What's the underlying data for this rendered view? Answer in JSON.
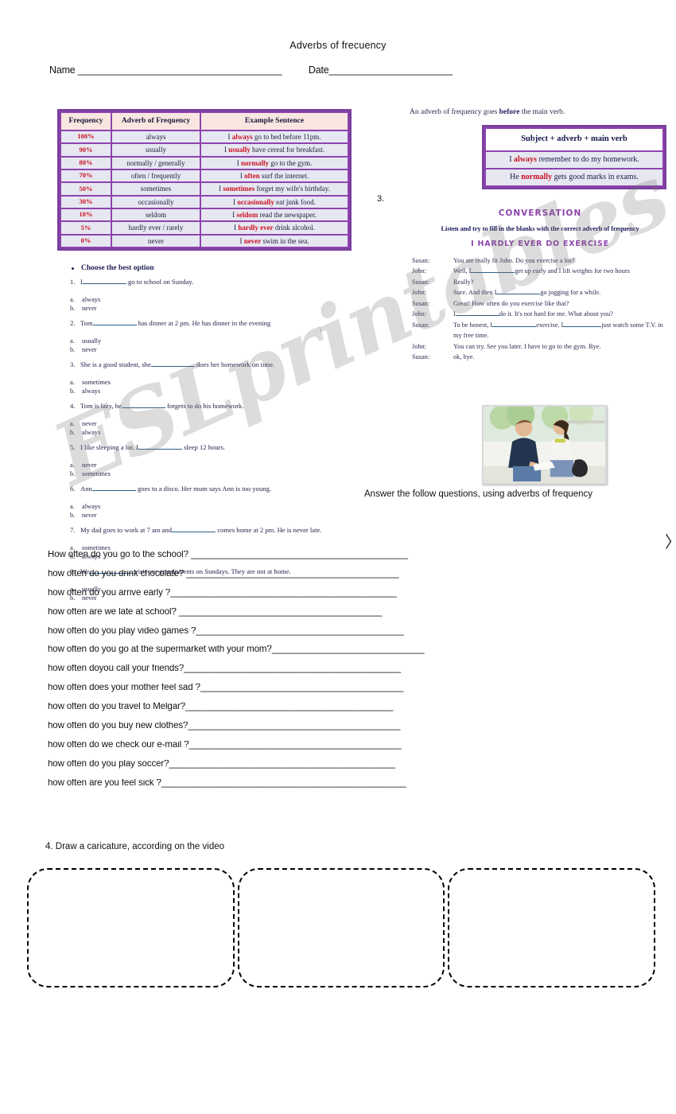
{
  "document": {
    "title": "Adverbs of frecuency",
    "name_label": "Name ______________________________________",
    "date_label": "Date_______________________",
    "watermark": "ESLprintables.com"
  },
  "frequency_table": {
    "headers": [
      "Frequency",
      "Adverb of Frequency",
      "Example Sentence"
    ],
    "rows": [
      {
        "pct": "100%",
        "adverb": "always",
        "prefix": "I ",
        "bold": "always",
        "suffix": " go to bed before 11pm."
      },
      {
        "pct": "90%",
        "adverb": "usually",
        "prefix": "I ",
        "bold": "usually",
        "suffix": " have cereal for breakfast."
      },
      {
        "pct": "80%",
        "adverb": "normally / generally",
        "prefix": "I ",
        "bold": "normally",
        "suffix": " go to the gym."
      },
      {
        "pct": "70%",
        "adverb": "often / frequently",
        "prefix": "I ",
        "bold": "often",
        "suffix": " surf the internet."
      },
      {
        "pct": "50%",
        "adverb": "sometimes",
        "prefix": "I ",
        "bold": "sometimes",
        "suffix": " forget my wife's birthday."
      },
      {
        "pct": "30%",
        "adverb": "occasionally",
        "prefix": "I ",
        "bold": "occasionally",
        "suffix": " eat junk food."
      },
      {
        "pct": "10%",
        "adverb": "seldom",
        "prefix": "I ",
        "bold": "seldom",
        "suffix": " read the newspaper."
      },
      {
        "pct": "5%",
        "adverb": "hardly ever / rarely",
        "prefix": "I ",
        "bold": "hardly ever",
        "suffix": " drink alcohol."
      },
      {
        "pct": "0%",
        "adverb": "never",
        "prefix": "I ",
        "bold": "never",
        "suffix": " swim in the sea."
      }
    ]
  },
  "rule": {
    "note_prefix": "An adverb of frequency goes ",
    "note_bold": "before",
    "note_suffix": " the main verb.",
    "formula": "Subject + adverb + main verb",
    "examples": [
      {
        "prefix": "I ",
        "bold": "always",
        "suffix": " remember to do my homework."
      },
      {
        "prefix": "He ",
        "bold": "normally",
        "suffix": " gets good marks in exams."
      }
    ]
  },
  "section_three_label": "3.",
  "multiple_choice": {
    "heading": "Choose the best option",
    "items": [
      {
        "num": "1.",
        "before": "I",
        "after": "go to school on Sunday.",
        "options": [
          "always",
          "never"
        ]
      },
      {
        "num": "2.",
        "before": "Tom",
        "after": "has dinner at 2 pm. He has dinner in the evening",
        "options": [
          "usually",
          "never"
        ]
      },
      {
        "num": "3.",
        "before": "She is a good student, she",
        "after": "does her homework on time.",
        "options": [
          "sometimes",
          "always"
        ]
      },
      {
        "num": "4.",
        "before": "Tom is lazy, he",
        "after": "forgets to do his homework.",
        "options": [
          "never",
          "always"
        ]
      },
      {
        "num": "5.",
        "before": "I like sleeping a lot. I",
        "after": "sleep 12 hours.",
        "options": [
          "never",
          "sometimes"
        ]
      },
      {
        "num": "6.",
        "before": "Ann",
        "after": "goes to a disco. Her mum says Ann is too young.",
        "options": [
          "always",
          "never"
        ]
      },
      {
        "num": "7.",
        "before": "My dad goes to work at 7 am and",
        "after": "comes home at 2 pm. He is never late.",
        "options": [
          "sometimes",
          "always"
        ]
      },
      {
        "num": "8.",
        "before": "We",
        "after": "visit our grandparents on Sundays. They are not at home.",
        "options": [
          "usually",
          "never"
        ]
      }
    ],
    "option_letters": [
      "a.",
      "b."
    ]
  },
  "conversation": {
    "title": "CONVERSATION",
    "instruction": "Listen and try to fill in the blanks with the correct adverb of frequency",
    "subtitle": "I HARDLY EVER DO EXERCISE",
    "lines": [
      {
        "speaker": "Susan:",
        "before": "You are really fit John. Do you exercise a lot?",
        "blank": false,
        "after": ""
      },
      {
        "speaker": "John:",
        "before": "Well, I",
        "blank": true,
        "after": "get up early and I lift weights for two hours"
      },
      {
        "speaker": "Susan:",
        "before": "Really?",
        "blank": false,
        "after": ""
      },
      {
        "speaker": "John:",
        "before": "Sure. And then I",
        "blank": true,
        "after": "go jogging for a while."
      },
      {
        "speaker": "Susan:",
        "before": "Great! How often do you exercise like that?",
        "blank": false,
        "after": ""
      },
      {
        "speaker": "John:",
        "before": "I",
        "blank": true,
        "after": "do it. It's not hard for me. What about you?"
      },
      {
        "speaker": "Susan:",
        "before": "To be honest, I",
        "blank": true,
        "after": "exercise. I",
        "blank2": true,
        "after2": "just watch some T.V. in my free time."
      },
      {
        "speaker": "John:",
        "before": "You can try. See you later. I have to go to the gym. Bye.",
        "blank": false,
        "after": ""
      },
      {
        "speaker": "Susan:",
        "before": "ok, bye.",
        "blank": false,
        "after": ""
      }
    ]
  },
  "answer_section": {
    "instruction": "Answer the follow questions, using adverbs of frequency",
    "questions": [
      {
        "text": "How often do you go to the school? ",
        "fill": "_______________________________________________"
      },
      {
        "text": "how often do you drink chocolate? ",
        "fill": "______________________________________________"
      },
      {
        "text": "how often do you arrive early ?",
        "fill": "_________________________________________________"
      },
      {
        "text": "how often  are we late at school? ",
        "fill": "____________________________________________"
      },
      {
        "text": "how often do you play video games ?",
        "fill": "_____________________________________________"
      },
      {
        "text": "how often do you go at the supermarket with your mom?",
        "fill": "_________________________________"
      },
      {
        "text": "how often doyou call your friends?",
        "fill": "_______________________________________________"
      },
      {
        "text": "how often does your mother feel sad ?",
        "fill": "____________________________________________"
      },
      {
        "text": "how often do you travel to Melgar?",
        "fill": "_____________________________________________"
      },
      {
        "text": "how often do you buy new clothes?",
        "fill": "______________________________________________"
      },
      {
        "text": "how often do we check our e-mail ?",
        "fill": "______________________________________________"
      },
      {
        "text": "how often do you play soccer?",
        "fill": "_________________________________________________"
      },
      {
        "text": "how often are you feel sick ?",
        "fill": "_____________________________________________________"
      }
    ]
  },
  "draw_section": {
    "label": "4. Draw a caricature, according on the video",
    "boxes": [
      "",
      "",
      ""
    ]
  },
  "colors": {
    "table_border": "#7b3fa0",
    "table_header_bg": "#fae6e1",
    "table_cell_bg": "#e6e7f1",
    "accent_red": "#cc1122",
    "conversation_title": "#8e44ad",
    "blank_line": "#2c5f8a"
  }
}
